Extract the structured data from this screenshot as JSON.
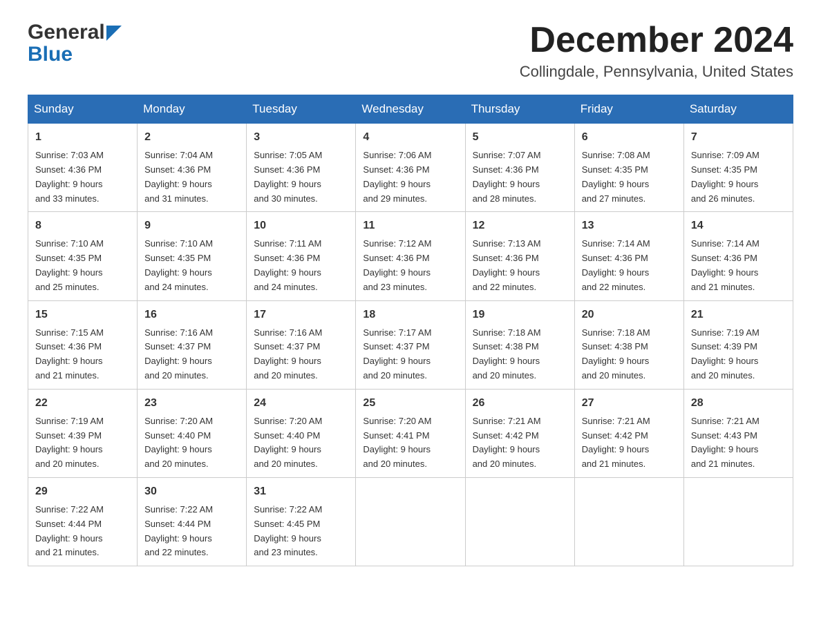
{
  "header": {
    "logo_general": "General",
    "logo_blue": "Blue",
    "month": "December 2024",
    "location": "Collingdale, Pennsylvania, United States"
  },
  "weekdays": [
    "Sunday",
    "Monday",
    "Tuesday",
    "Wednesday",
    "Thursday",
    "Friday",
    "Saturday"
  ],
  "weeks": [
    [
      {
        "day": "1",
        "sunrise": "7:03 AM",
        "sunset": "4:36 PM",
        "daylight": "9 hours and 33 minutes."
      },
      {
        "day": "2",
        "sunrise": "7:04 AM",
        "sunset": "4:36 PM",
        "daylight": "9 hours and 31 minutes."
      },
      {
        "day": "3",
        "sunrise": "7:05 AM",
        "sunset": "4:36 PM",
        "daylight": "9 hours and 30 minutes."
      },
      {
        "day": "4",
        "sunrise": "7:06 AM",
        "sunset": "4:36 PM",
        "daylight": "9 hours and 29 minutes."
      },
      {
        "day": "5",
        "sunrise": "7:07 AM",
        "sunset": "4:36 PM",
        "daylight": "9 hours and 28 minutes."
      },
      {
        "day": "6",
        "sunrise": "7:08 AM",
        "sunset": "4:35 PM",
        "daylight": "9 hours and 27 minutes."
      },
      {
        "day": "7",
        "sunrise": "7:09 AM",
        "sunset": "4:35 PM",
        "daylight": "9 hours and 26 minutes."
      }
    ],
    [
      {
        "day": "8",
        "sunrise": "7:10 AM",
        "sunset": "4:35 PM",
        "daylight": "9 hours and 25 minutes."
      },
      {
        "day": "9",
        "sunrise": "7:10 AM",
        "sunset": "4:35 PM",
        "daylight": "9 hours and 24 minutes."
      },
      {
        "day": "10",
        "sunrise": "7:11 AM",
        "sunset": "4:36 PM",
        "daylight": "9 hours and 24 minutes."
      },
      {
        "day": "11",
        "sunrise": "7:12 AM",
        "sunset": "4:36 PM",
        "daylight": "9 hours and 23 minutes."
      },
      {
        "day": "12",
        "sunrise": "7:13 AM",
        "sunset": "4:36 PM",
        "daylight": "9 hours and 22 minutes."
      },
      {
        "day": "13",
        "sunrise": "7:14 AM",
        "sunset": "4:36 PM",
        "daylight": "9 hours and 22 minutes."
      },
      {
        "day": "14",
        "sunrise": "7:14 AM",
        "sunset": "4:36 PM",
        "daylight": "9 hours and 21 minutes."
      }
    ],
    [
      {
        "day": "15",
        "sunrise": "7:15 AM",
        "sunset": "4:36 PM",
        "daylight": "9 hours and 21 minutes."
      },
      {
        "day": "16",
        "sunrise": "7:16 AM",
        "sunset": "4:37 PM",
        "daylight": "9 hours and 20 minutes."
      },
      {
        "day": "17",
        "sunrise": "7:16 AM",
        "sunset": "4:37 PM",
        "daylight": "9 hours and 20 minutes."
      },
      {
        "day": "18",
        "sunrise": "7:17 AM",
        "sunset": "4:37 PM",
        "daylight": "9 hours and 20 minutes."
      },
      {
        "day": "19",
        "sunrise": "7:18 AM",
        "sunset": "4:38 PM",
        "daylight": "9 hours and 20 minutes."
      },
      {
        "day": "20",
        "sunrise": "7:18 AM",
        "sunset": "4:38 PM",
        "daylight": "9 hours and 20 minutes."
      },
      {
        "day": "21",
        "sunrise": "7:19 AM",
        "sunset": "4:39 PM",
        "daylight": "9 hours and 20 minutes."
      }
    ],
    [
      {
        "day": "22",
        "sunrise": "7:19 AM",
        "sunset": "4:39 PM",
        "daylight": "9 hours and 20 minutes."
      },
      {
        "day": "23",
        "sunrise": "7:20 AM",
        "sunset": "4:40 PM",
        "daylight": "9 hours and 20 minutes."
      },
      {
        "day": "24",
        "sunrise": "7:20 AM",
        "sunset": "4:40 PM",
        "daylight": "9 hours and 20 minutes."
      },
      {
        "day": "25",
        "sunrise": "7:20 AM",
        "sunset": "4:41 PM",
        "daylight": "9 hours and 20 minutes."
      },
      {
        "day": "26",
        "sunrise": "7:21 AM",
        "sunset": "4:42 PM",
        "daylight": "9 hours and 20 minutes."
      },
      {
        "day": "27",
        "sunrise": "7:21 AM",
        "sunset": "4:42 PM",
        "daylight": "9 hours and 21 minutes."
      },
      {
        "day": "28",
        "sunrise": "7:21 AM",
        "sunset": "4:43 PM",
        "daylight": "9 hours and 21 minutes."
      }
    ],
    [
      {
        "day": "29",
        "sunrise": "7:22 AM",
        "sunset": "4:44 PM",
        "daylight": "9 hours and 21 minutes."
      },
      {
        "day": "30",
        "sunrise": "7:22 AM",
        "sunset": "4:44 PM",
        "daylight": "9 hours and 22 minutes."
      },
      {
        "day": "31",
        "sunrise": "7:22 AM",
        "sunset": "4:45 PM",
        "daylight": "9 hours and 23 minutes."
      },
      null,
      null,
      null,
      null
    ]
  ],
  "labels": {
    "sunrise": "Sunrise:",
    "sunset": "Sunset:",
    "daylight": "Daylight:"
  }
}
